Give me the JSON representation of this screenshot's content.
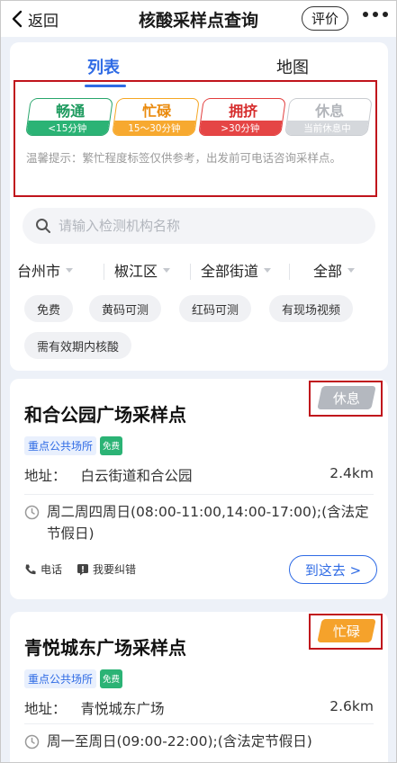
{
  "nav": {
    "back_label": "返回",
    "title": "核酸采样点查询",
    "rate_label": "评价"
  },
  "tabs": [
    {
      "label": "列表",
      "active": true
    },
    {
      "label": "地图",
      "active": false
    }
  ],
  "legend": [
    {
      "label": "畅通",
      "sub": "<15分钟",
      "color": "#27a56b"
    },
    {
      "label": "忙碌",
      "sub": "15～30分钟",
      "color": "#f5a623"
    },
    {
      "label": "拥挤",
      "sub": ">30分钟",
      "color": "#e23c3c"
    },
    {
      "label": "休息",
      "sub": "当前休息中",
      "color": "#c9ccd1"
    }
  ],
  "tip": "温馨提示：繁忙程度标签仅供参考，出发前可电话咨询采样点。",
  "search": {
    "placeholder": "请输入检测机构名称",
    "value": ""
  },
  "filters": [
    "台州市",
    "椒江区",
    "全部街道",
    "全部"
  ],
  "chips": [
    "免费",
    "黄码可测",
    "红码可测",
    "有现场视频",
    "需有效期内核酸"
  ],
  "sites": [
    {
      "name": "和合公园广场采样点",
      "status": "休息",
      "status_color": "#b4b8bf",
      "tag": "重点公共场所",
      "free_tag": "免费",
      "address_label": "地址：",
      "address": "白云街道和合公园",
      "distance": "2.4km",
      "hours": "周二周四周日(08:00-11:00,14:00-17:00);(含法定节假日)",
      "phone_label": "电话",
      "report_label": "我要纠错",
      "go_label": "到这去 >"
    },
    {
      "name": "青悦城东广场采样点",
      "status": "忙碌",
      "status_color": "#f5a22b",
      "tag": "重点公共场所",
      "free_tag": "免费",
      "address_label": "地址：",
      "address": "青悦城东广场",
      "distance": "2.6km",
      "hours": "周一至周日(09:00-22:00);(含法定节假日)"
    }
  ]
}
